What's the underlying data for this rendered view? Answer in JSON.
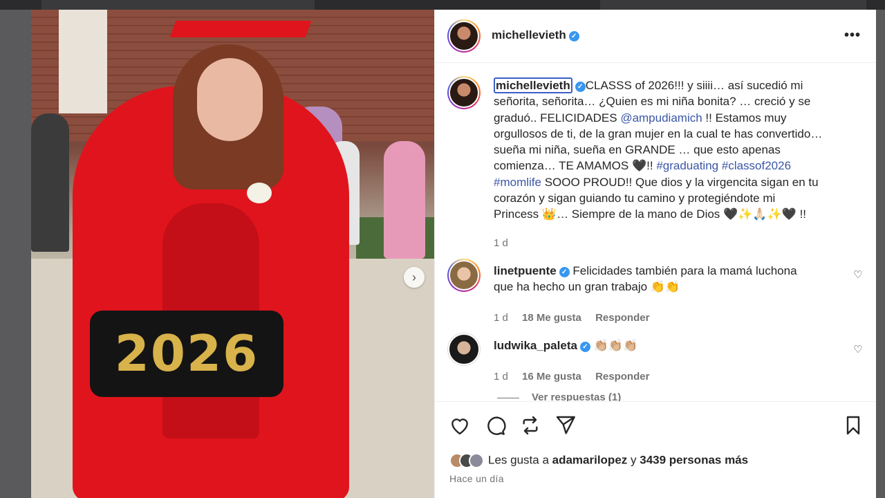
{
  "post": {
    "author": "michellevieth",
    "caption_lines": [
      "CLASSS of 2026!!! y siiii… así sucedió mi",
      "señorita, señorita… ¿Quien es mi niña bonita? … creció y se",
      "graduó.. FELICIDADES ",
      " !! Estamos muy",
      "orgullosos de ti, de la gran mujer en la cual te has convertido…",
      "sueña mi niña, sueña en GRANDE … que esto apenas",
      "comienza… TE AMAMOS 🖤!! ",
      " SOOO PROUD!! Que dios y la virgencita sigan en tu",
      "corazón y sigan guiando tu camino y protegiéndote mi",
      "Princess 👑… Siempre de la mano de Dios 🖤✨🙏🏻✨🖤 !!"
    ],
    "mention": "@ampudiamich",
    "tags": [
      "#graduating",
      "#classof2026",
      "#momlife"
    ],
    "caption_age": "1 d",
    "image_sign_text": "2026"
  },
  "comments": [
    {
      "user": "linetpuente",
      "line1": "Felicidades también para la mamá luchona",
      "line2": "que ha hecho un gran trabajo 👏👏",
      "age": "1 d",
      "likes": "18 Me gusta",
      "reply": "Responder"
    },
    {
      "user": "ludwika_paleta",
      "line1": "👏🏼👏🏼👏🏼",
      "age": "1 d",
      "likes": "16 Me gusta",
      "reply": "Responder",
      "view_replies": "Ver respuestas (1)"
    }
  ],
  "footer": {
    "likes_prefix": "Les gusta a ",
    "likes_user": "adamarilopez",
    "likes_mid": " y ",
    "likes_count": "3439 personas más",
    "posted": "Hace un día"
  },
  "icons": {
    "more": "more-options-icon",
    "like": "heart-icon",
    "comment": "comment-icon",
    "repost": "repost-icon",
    "share": "send-icon",
    "save": "bookmark-icon",
    "next": "chevron-right-icon",
    "verified": "verified-badge-icon"
  },
  "colors": {
    "link": "#3b57a5",
    "verified": "#3797f0",
    "text": "#262626",
    "muted": "#737373"
  }
}
